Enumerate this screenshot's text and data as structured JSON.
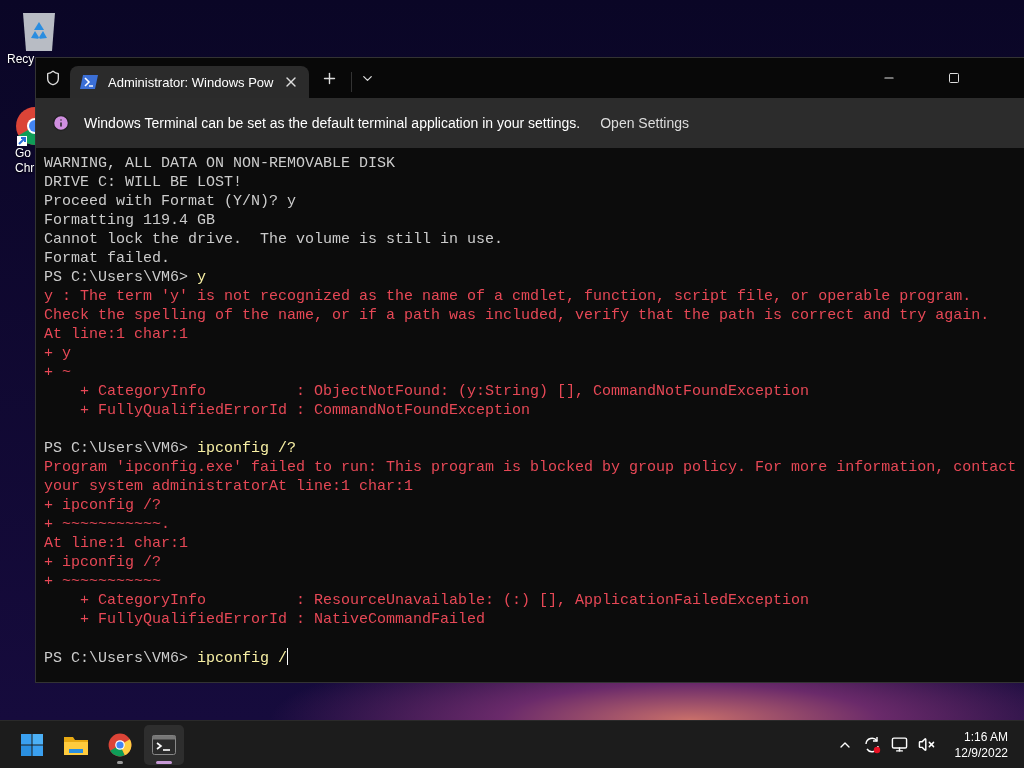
{
  "desktop_icons": [
    {
      "kind": "recycle",
      "lines": [
        "Recy"
      ]
    },
    {
      "kind": "browser",
      "lines": [
        "Go",
        "Chr"
      ]
    }
  ],
  "window": {
    "tab": {
      "title": "Administrator: Windows Pow",
      "selected": true
    },
    "infobar": {
      "message": "Windows Terminal can be set as the default terminal application in your settings.",
      "action": "Open Settings"
    },
    "lines": [
      {
        "kind": "output",
        "text": "WARNING, ALL DATA ON NON-REMOVABLE DISK"
      },
      {
        "kind": "output",
        "text": "DRIVE C: WILL BE LOST!"
      },
      {
        "kind": "output",
        "text": "Proceed with Format (Y/N)? y"
      },
      {
        "kind": "output",
        "text": "Formatting 119.4 GB"
      },
      {
        "kind": "output",
        "text": "Cannot lock the drive.  The volume is still in use."
      },
      {
        "kind": "output",
        "text": "Format failed."
      },
      {
        "kind": "prompt",
        "prompt": "PS C:\\Users\\VM6> ",
        "command": "y",
        "cursor": false
      },
      {
        "kind": "error",
        "text": "y : The term 'y' is not recognized as the name of a cmdlet, function, script file, or operable program."
      },
      {
        "kind": "error",
        "text": "Check the spelling of the name, or if a path was included, verify that the path is correct and try again."
      },
      {
        "kind": "error",
        "text": "At line:1 char:1"
      },
      {
        "kind": "error",
        "text": "+ y"
      },
      {
        "kind": "error",
        "text": "+ ~"
      },
      {
        "kind": "error",
        "text": "    + CategoryInfo          : ObjectNotFound: (y:String) [], CommandNotFoundException"
      },
      {
        "kind": "error",
        "text": "    + FullyQualifiedErrorId : CommandNotFoundException"
      },
      {
        "kind": "blank"
      },
      {
        "kind": "prompt",
        "prompt": "PS C:\\Users\\VM6> ",
        "command": "ipconfig /?",
        "cursor": false
      },
      {
        "kind": "error",
        "text": "Program 'ipconfig.exe' failed to run: This program is blocked by group policy. For more information, contact"
      },
      {
        "kind": "error",
        "text": "your system administratorAt line:1 char:1"
      },
      {
        "kind": "error",
        "text": "+ ipconfig /?"
      },
      {
        "kind": "error",
        "text": "+ ~~~~~~~~~~~."
      },
      {
        "kind": "error",
        "text": "At line:1 char:1"
      },
      {
        "kind": "error",
        "text": "+ ipconfig /?"
      },
      {
        "kind": "error",
        "text": "+ ~~~~~~~~~~~"
      },
      {
        "kind": "error",
        "text": "    + CategoryInfo          : ResourceUnavailable: (:) [], ApplicationFailedException"
      },
      {
        "kind": "error",
        "text": "    + FullyQualifiedErrorId : NativeCommandFailed"
      },
      {
        "kind": "blank"
      },
      {
        "kind": "prompt",
        "prompt": "PS C:\\Users\\VM6> ",
        "command": "ipconfig /",
        "cursor": true
      }
    ]
  },
  "taskbar": {
    "apps": [
      {
        "kind": "start",
        "running": false,
        "selected": false
      },
      {
        "kind": "folder",
        "running": false,
        "selected": false
      },
      {
        "kind": "browser",
        "running": true,
        "selected": false
      },
      {
        "kind": "terminal",
        "running": true,
        "selected": true
      }
    ],
    "time": "1:16 AM",
    "date": "12/9/2022"
  }
}
